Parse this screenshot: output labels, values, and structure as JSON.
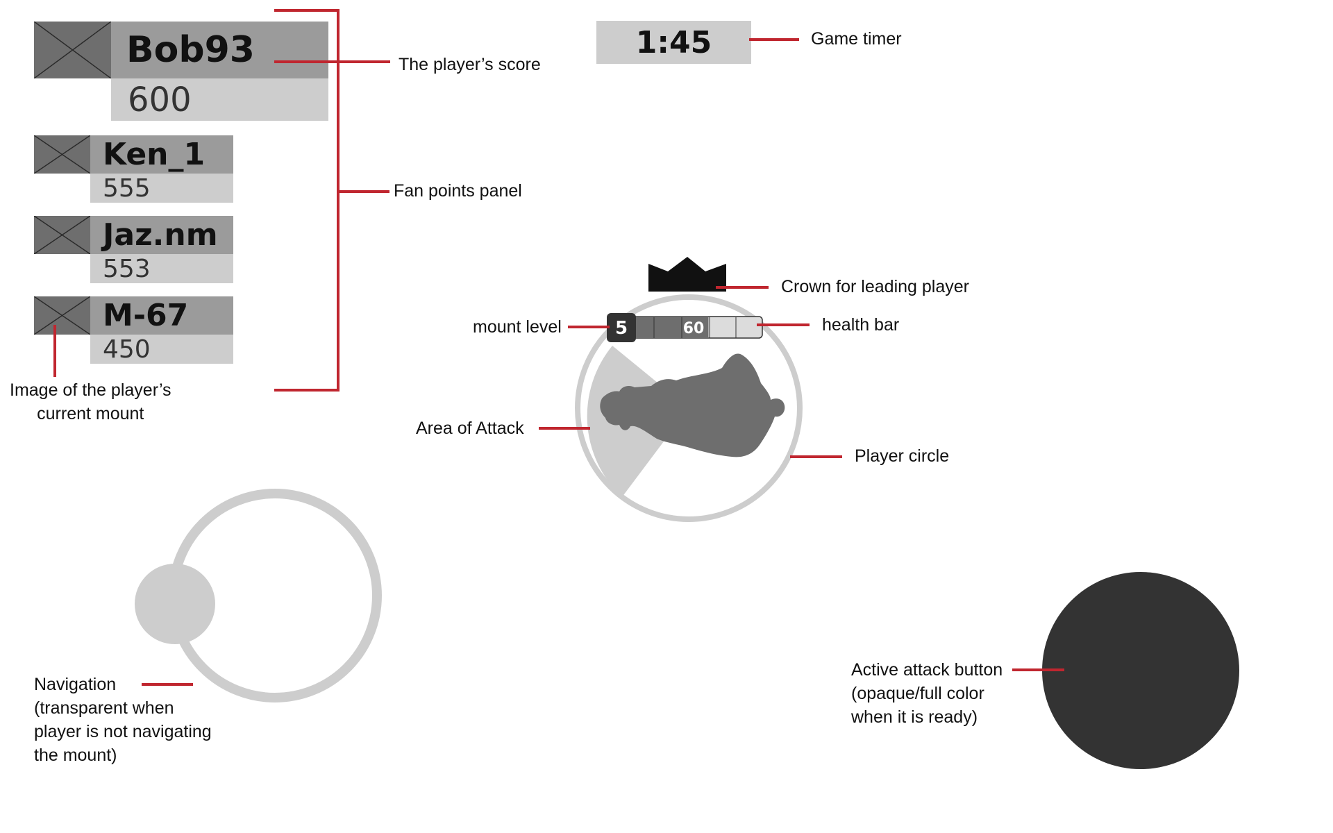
{
  "players": [
    {
      "name": "Bob93",
      "score": "600"
    },
    {
      "name": "Ken_1",
      "score": "555"
    },
    {
      "name": "Jaz.nm",
      "score": "553"
    },
    {
      "name": "M-67",
      "score": "450"
    }
  ],
  "timer": "1:45",
  "hud": {
    "mount_level": "5",
    "health_value": "60"
  },
  "labels": {
    "player_score": "The player’s score",
    "fan_points_panel": "Fan points panel",
    "game_timer": "Game timer",
    "crown": "Crown for leading player",
    "mount_level": "mount level",
    "health_bar": "health bar",
    "area_of_attack": "Area of Attack",
    "player_circle": "Player circle",
    "mount_image": [
      "Image of the player’s",
      "current mount"
    ],
    "navigation": [
      "Navigation",
      "(transparent when",
      "player is not navigating",
      "the mount)"
    ],
    "attack_button": [
      "Active attack button",
      "(opaque/full color",
      "when it is ready)"
    ]
  },
  "colors": {
    "callout": "#c0262f",
    "dark": "#333333",
    "mid": "#6e6e6e",
    "light": "#cdcdcd"
  }
}
